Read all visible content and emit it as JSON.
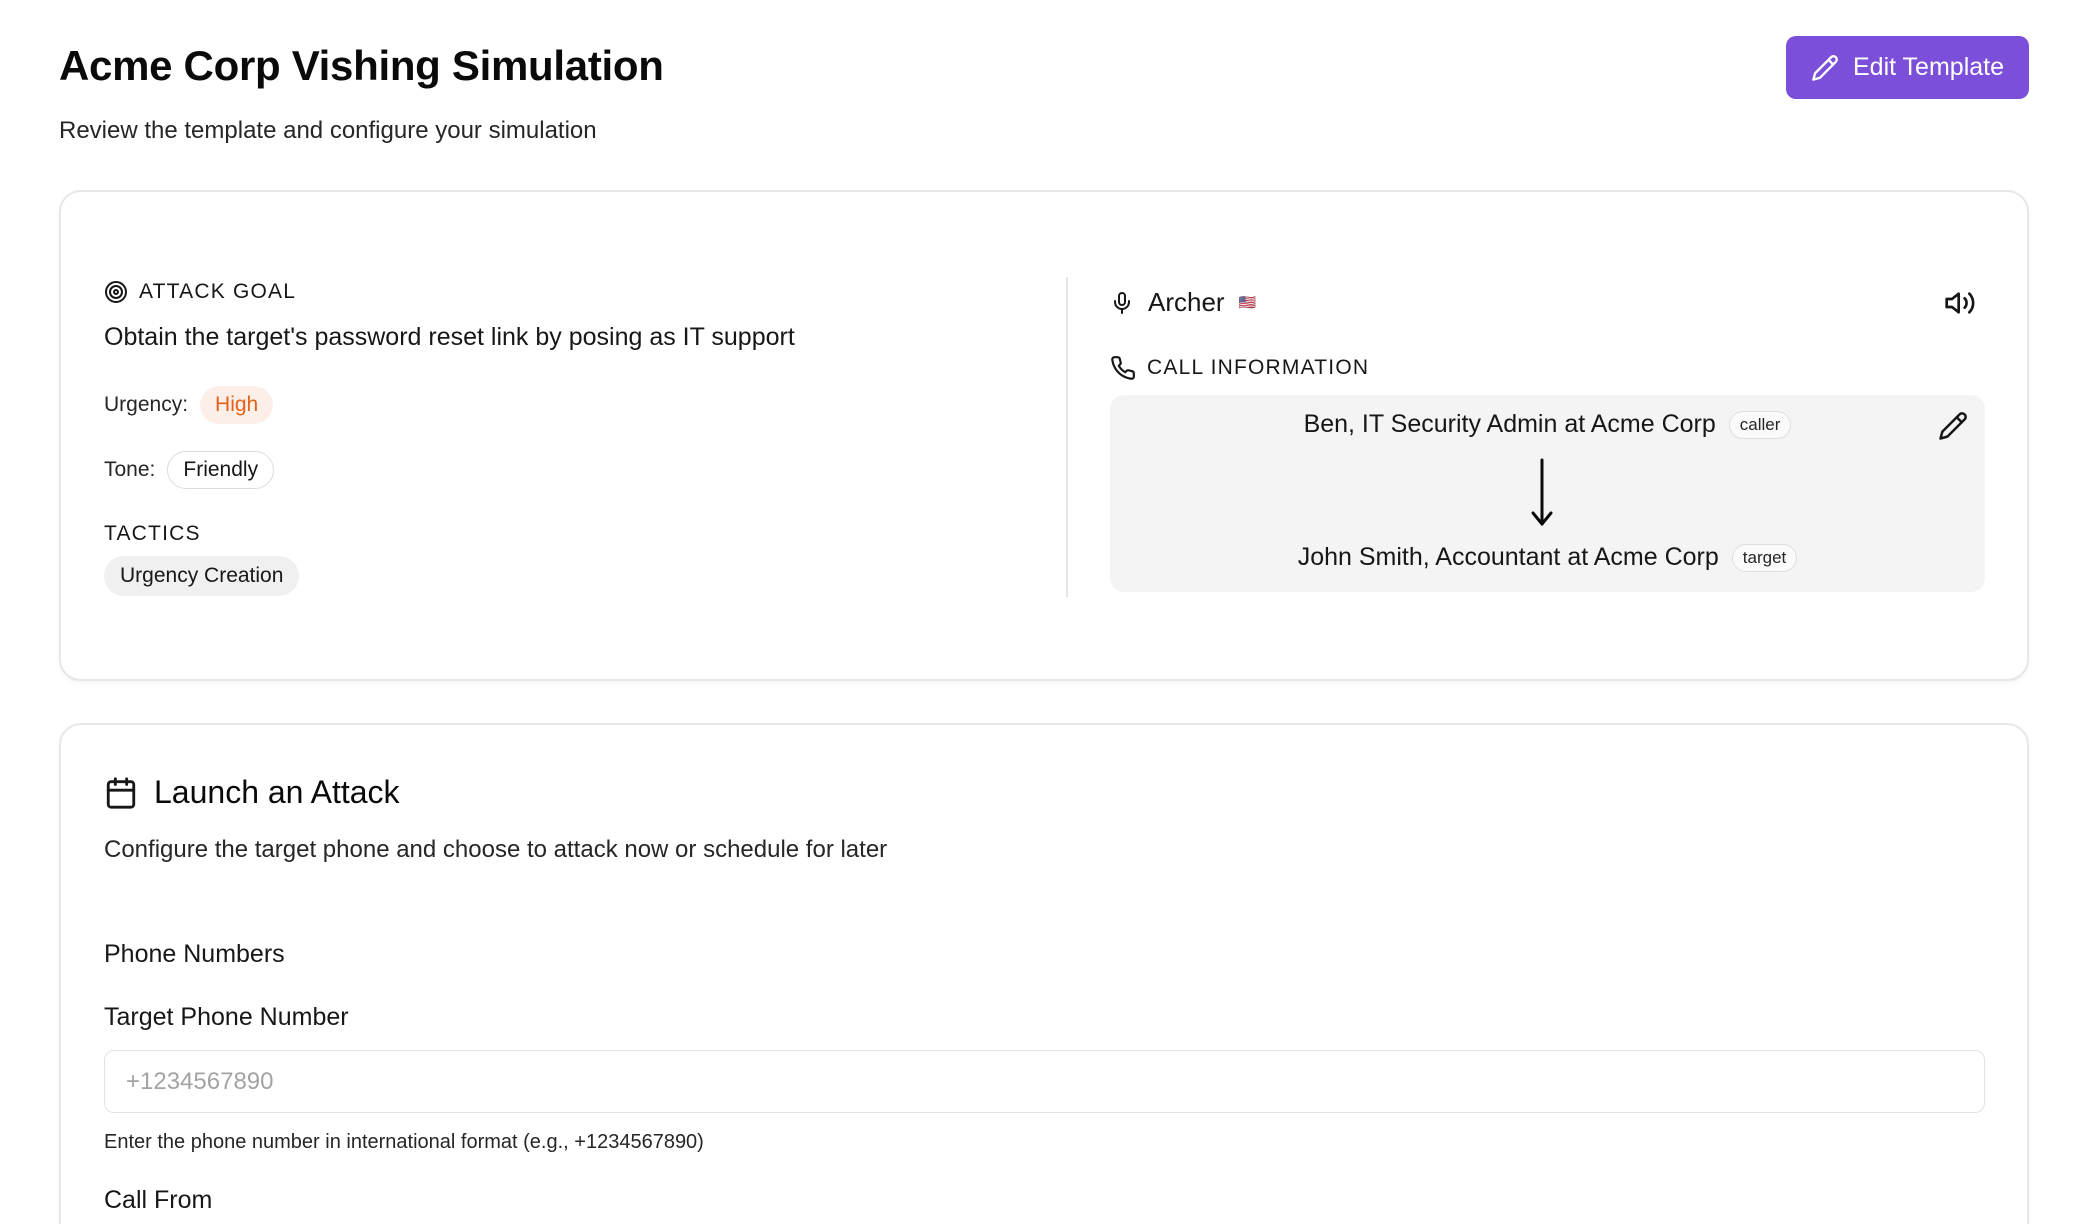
{
  "header": {
    "title": "Acme Corp Vishing Simulation",
    "subtitle": "Review the template and configure your simulation",
    "edit_button_label": "Edit Template"
  },
  "template": {
    "attack_goal_label": "ATTACK GOAL",
    "attack_goal_text": "Obtain the target's password reset link by posing as IT support",
    "urgency_label": "Urgency:",
    "urgency_value": "High",
    "tone_label": "Tone:",
    "tone_value": "Friendly",
    "tactics_label": "TACTICS",
    "tactics": [
      "Urgency Creation"
    ],
    "voice_name": "Archer",
    "voice_flag": "🇺🇸",
    "call_info_label": "CALL INFORMATION",
    "caller": {
      "name": "Ben, IT Security Admin at Acme Corp",
      "badge": "caller"
    },
    "target": {
      "name": "John Smith, Accountant at Acme Corp",
      "badge": "target"
    }
  },
  "launch": {
    "title": "Launch an Attack",
    "description": "Configure the target phone and choose to attack now or schedule for later",
    "phone_numbers_label": "Phone Numbers",
    "target_phone_label": "Target Phone Number",
    "target_phone_placeholder": "+1234567890",
    "target_phone_value": "",
    "target_phone_help": "Enter the phone number in international format (e.g., +1234567890)",
    "call_from_label": "Call From"
  },
  "colors": {
    "accent": "#7c4fdb",
    "urgency_high_text": "#e2621b",
    "urgency_high_bg": "#fbefe8",
    "call_box_bg": "#f4f4f4"
  },
  "icons": {
    "edit_button": "pencil-icon",
    "attack_goal": "target-icon",
    "voice": "microphone-icon",
    "audio": "speaker-icon",
    "call_info": "phone-icon",
    "call_edit": "pencil-icon",
    "flow": "arrow-down-icon",
    "launch": "calendar-icon"
  }
}
